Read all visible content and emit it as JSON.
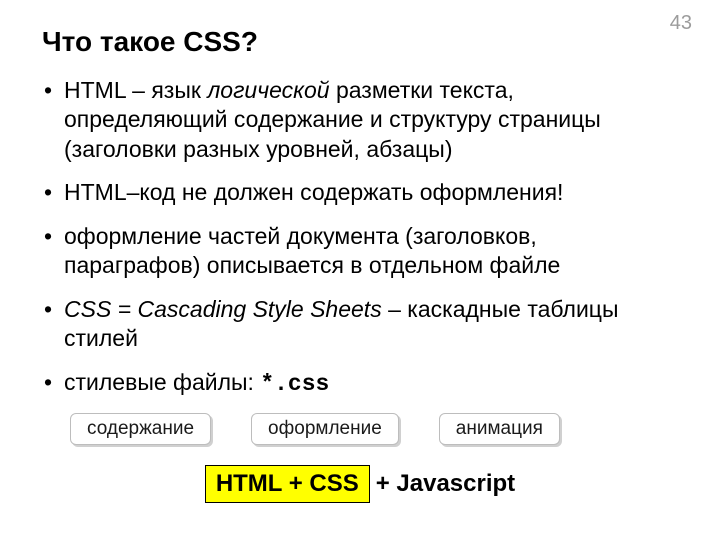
{
  "pageNumber": "43",
  "title": "Что такое CSS?",
  "bullets": {
    "b1a": "HTML – язык ",
    "b1i": "логической",
    "b1b": " разметки текста, определяющий содержание и структуру страницы (заголовки разных уровней, абзацы)",
    "b2": "HTML–код не должен содержать оформления!",
    "b3": "оформление частей документа (заголовков, параграфов) описывается в отдельном файле",
    "b4i": "CSS = Cascading Style Sheets",
    "b4b": " – каскадные таблицы стилей",
    "b5a": "стилевые файлы: ",
    "b5m": "*.css"
  },
  "tags": {
    "content": "содержание",
    "style": "оформление",
    "anim": "анимация"
  },
  "formula": {
    "highlight": "HTML + CSS",
    "rest": " + Javascript"
  }
}
